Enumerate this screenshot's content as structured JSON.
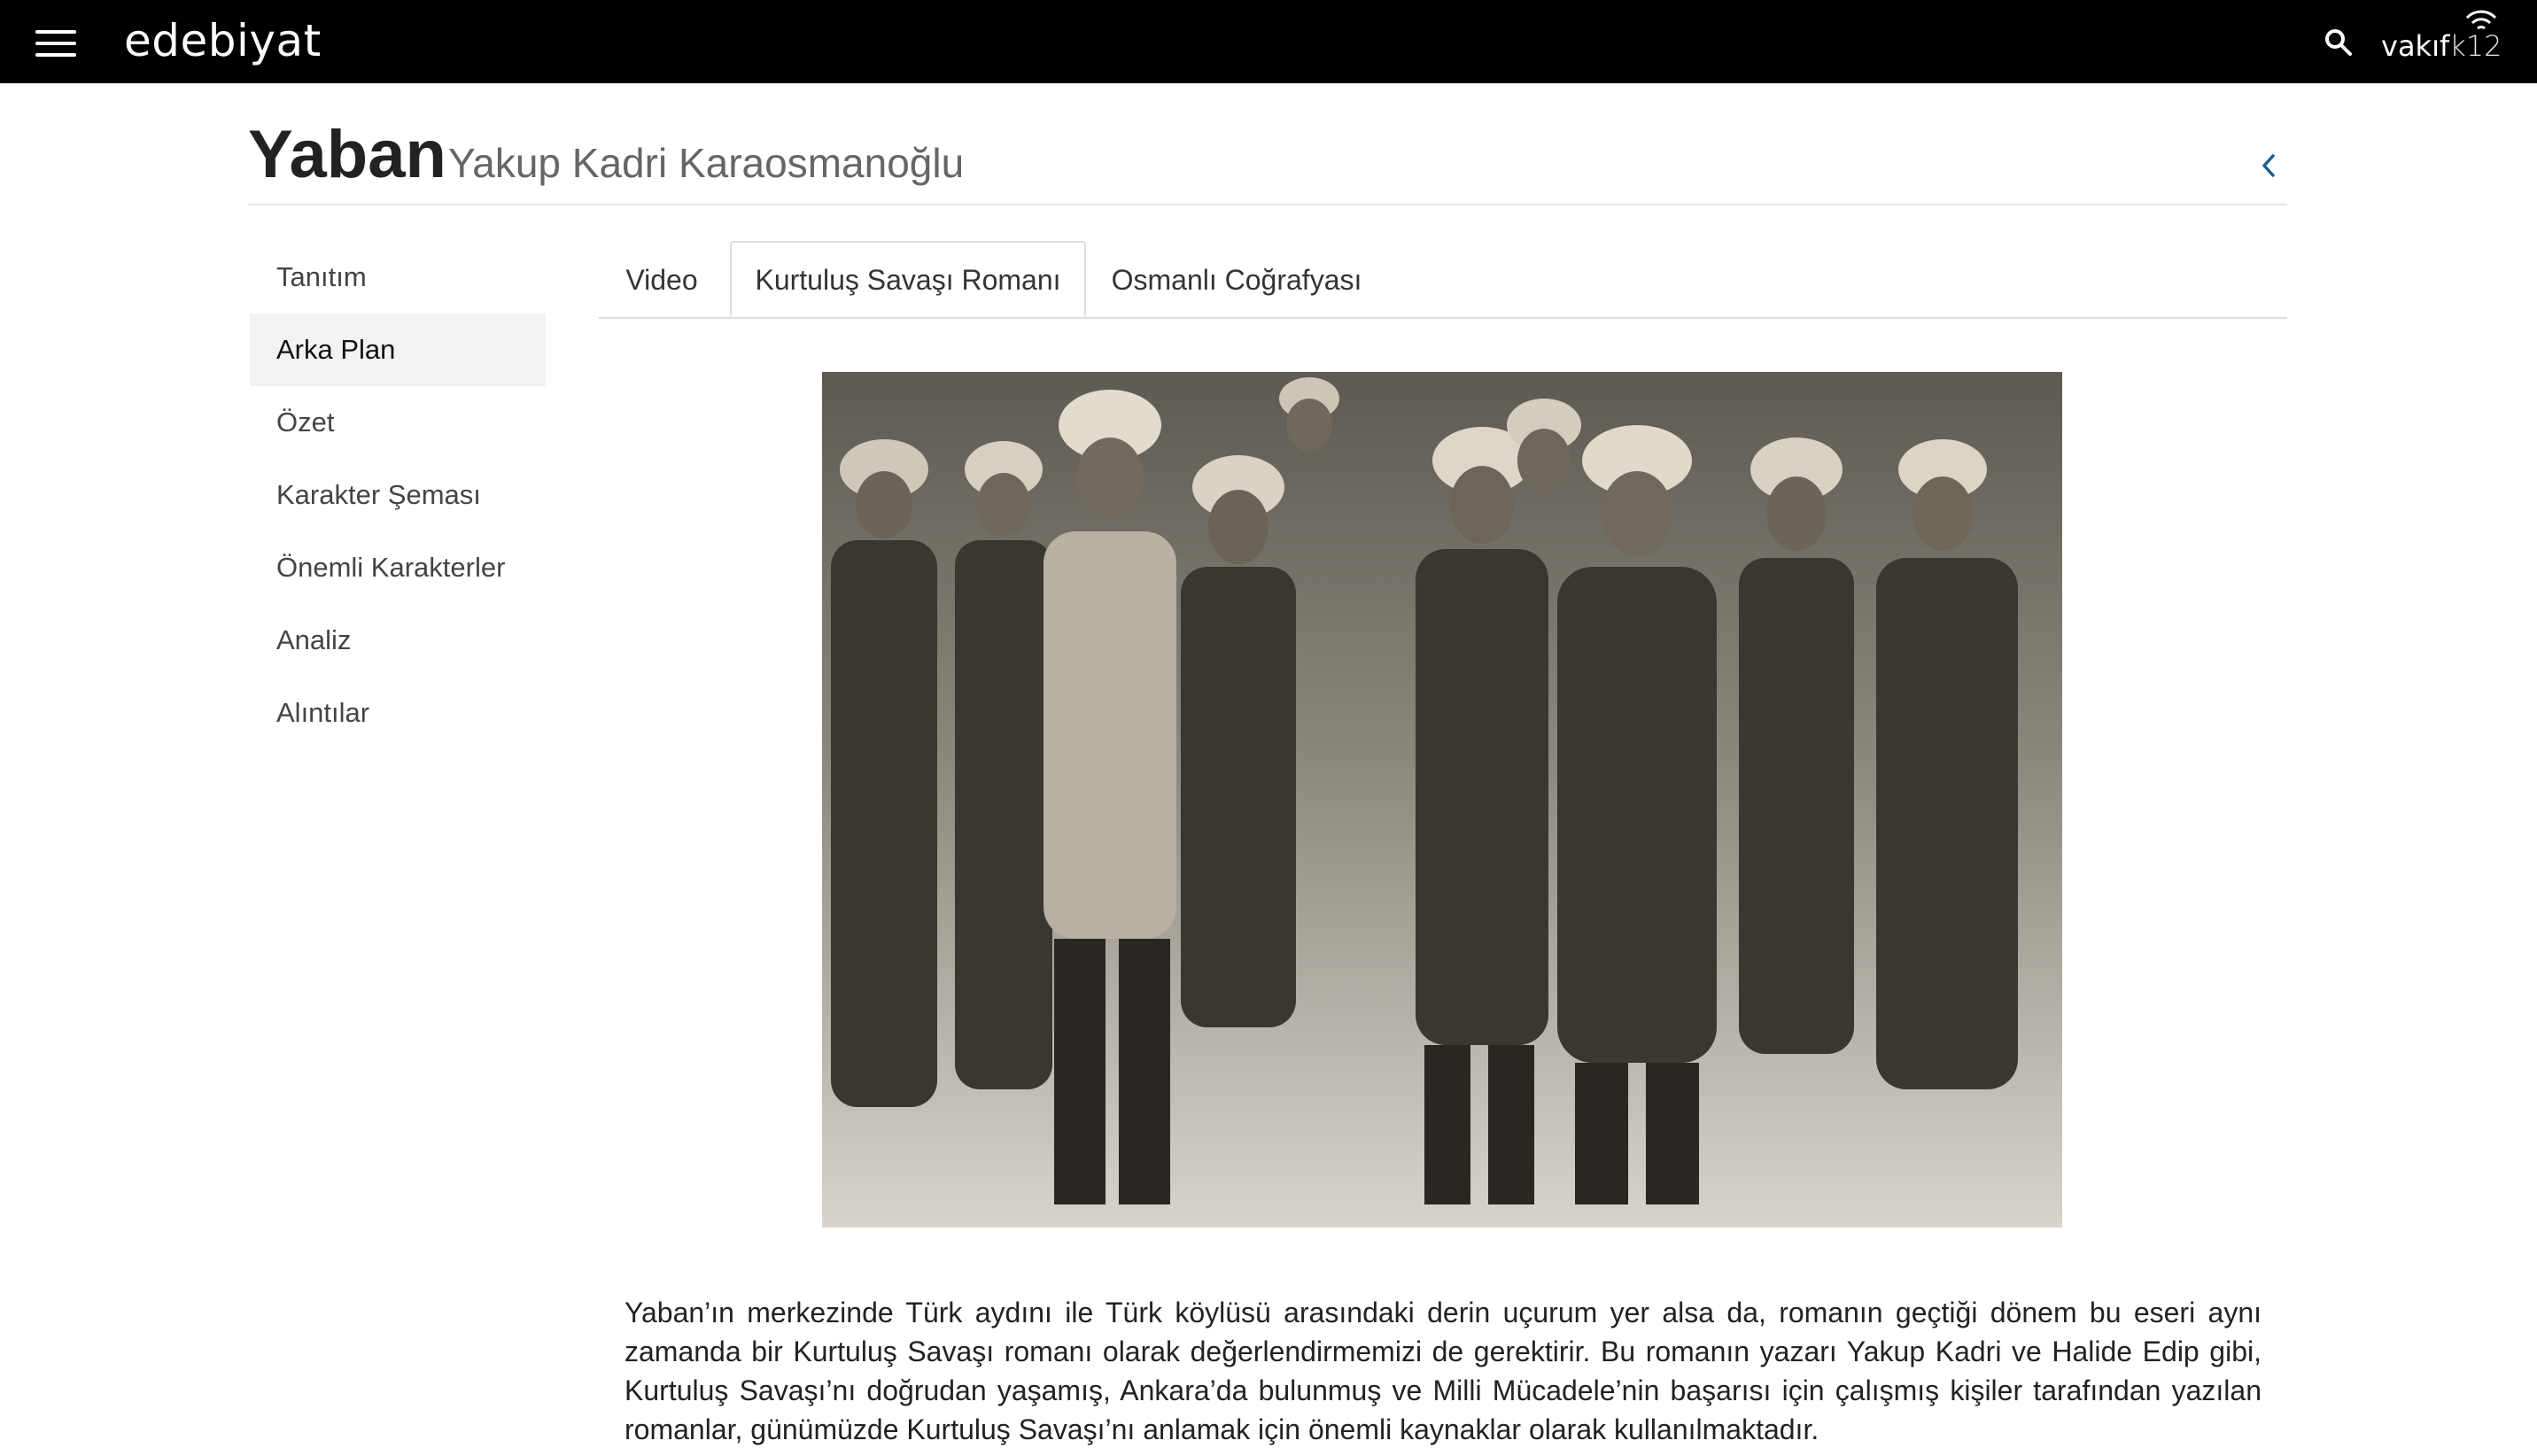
{
  "header": {
    "brand": "edebiyat",
    "partner_logo": "vakıfk12",
    "partner_logo_main": "vakıf",
    "partner_logo_suffix": "k12",
    "icons": [
      "menu-icon",
      "search-icon",
      "wifi-icon"
    ],
    "background_color": "#000000"
  },
  "page": {
    "title": "Yaban",
    "author": "Yakup Kadri Karaosmanoğlu",
    "back_icon": "chevron-left-icon",
    "accent_color": "#1f5f8b"
  },
  "sidebar": {
    "items": [
      {
        "label": "Tanıtım",
        "active": false
      },
      {
        "label": "Arka Plan",
        "active": true
      },
      {
        "label": "Özet",
        "active": false
      },
      {
        "label": "Karakter Şeması",
        "active": false
      },
      {
        "label": "Önemli Karakterler",
        "active": false
      },
      {
        "label": "Analiz",
        "active": false
      },
      {
        "label": "Alıntılar",
        "active": false
      }
    ]
  },
  "tabs": {
    "items": [
      {
        "label": "Video",
        "active": false
      },
      {
        "label": "Kurtuluş Savaşı Romanı",
        "active": true
      },
      {
        "label": "Osmanlı Coğrafyası",
        "active": false
      }
    ]
  },
  "content": {
    "paragraph": "Yaban’ın merkezinde Türk aydını ile Türk köylüsü arasındaki derin uçurum yer alsa da, romanın geçtiği dönem bu eseri aynı zamanda bir Kurtuluş Savaşı romanı olarak değerlendirmemizi de gerektirir. Bu romanın yazarı Yakup Kadri ve Halide Edip gibi, Kurtuluş Savaşı’nı doğrudan yaşamış, Ankara’da bulunmuş ve Milli Mücadele’nin başarısı için çalışmış kişiler tarafından yazılan romanlar, günümüzde Kurtuluş Savaşı’nı anlamak için önemli kaynaklar olarak kullanılmaktadır."
  }
}
